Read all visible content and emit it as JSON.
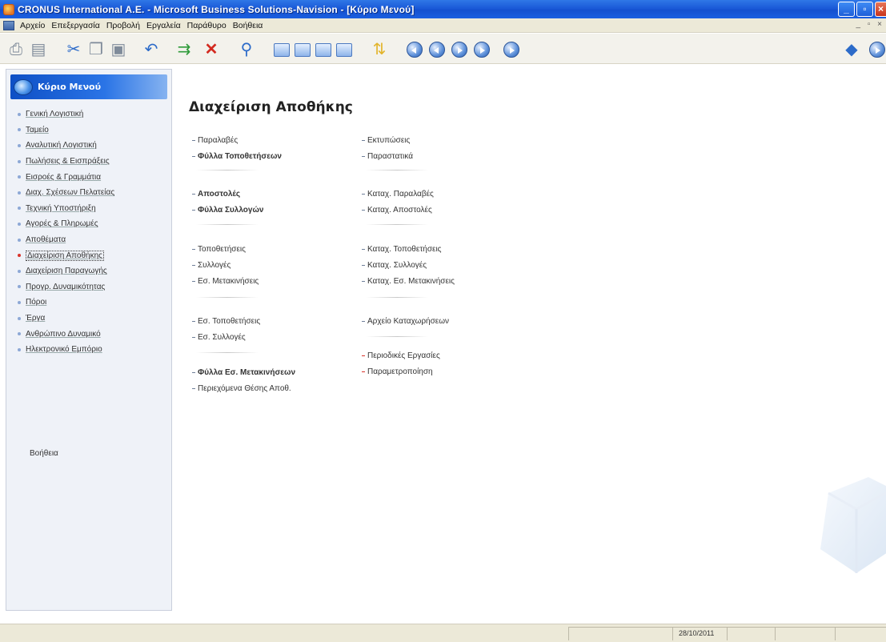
{
  "window": {
    "title": "CRONUS International A.E. - Microsoft Business Solutions-Navision - [Κύριο Μενού]"
  },
  "menubar": {
    "items": [
      "Αρχείο",
      "Επεξεργασία",
      "Προβολή",
      "Εργαλεία",
      "Παράθυρο",
      "Βοήθεια"
    ],
    "mdi_controls": "_ ▫ ×"
  },
  "toolbar": {
    "icons": [
      "print-icon",
      "print-preview-icon",
      "cut-icon",
      "copy-icon",
      "paste-icon",
      "undo-icon",
      "export-icon",
      "delete-icon",
      "find-icon",
      "card-view-icon",
      "list-view-icon",
      "statistics-icon",
      "table-icon",
      "sort-icon",
      "first-record-icon",
      "previous-record-icon",
      "next-record-icon",
      "last-record-icon",
      "navigate-icon",
      "menu-globe-icon",
      "help-icon"
    ]
  },
  "nav": {
    "header": "Κύριο Μενού",
    "items": [
      "Γενική Λογιστική",
      "Ταμείο",
      "Αναλυτική Λογιστική",
      "Πωλήσεις & Εισπράξεις",
      "Εισροές & Γραμμάτια",
      "Διαχ. Σχέσεων Πελατείας",
      "Τεχνική Υποστήριξη",
      "Αγορές & Πληρωμές",
      "Αποθέματα",
      "Διαχείριση Αποθήκης",
      "Διαχείριση Παραγωγής",
      "Προγρ. Δυναμικότητας",
      "Πόροι",
      "Έργα",
      "Ανθρώπινο Δυναμικό",
      "Ηλεκτρονικό Εμπόριο"
    ],
    "active_index": 9,
    "help": "Βοήθεια"
  },
  "main": {
    "title": "Διαχείριση Αποθήκης",
    "left_column": [
      {
        "label": "Παραλαβές"
      },
      {
        "label": "Φύλλα Τοποθετήσεων"
      },
      {
        "label": "Αποστολές"
      },
      {
        "label": "Φύλλα Συλλογών"
      },
      {
        "label": "Τοποθετήσεις"
      },
      {
        "label": "Συλλογές"
      },
      {
        "label": "Εσ. Μετακινήσεις"
      },
      {
        "label": "Εσ. Τοποθετήσεις"
      },
      {
        "label": "Εσ. Συλλογές"
      },
      {
        "label": "Φύλλα Εσ. Μετακινήσεων"
      },
      {
        "label": "Περιεχόμενα Θέσης Αποθ."
      }
    ],
    "right_column": [
      {
        "label": "Εκτυπώσεις"
      },
      {
        "label": "Παραστατικά"
      },
      {
        "label": "Καταχ. Παραλαβές"
      },
      {
        "label": "Καταχ. Αποστολές"
      },
      {
        "label": "Καταχ. Τοποθετήσεις"
      },
      {
        "label": "Καταχ. Συλλογές"
      },
      {
        "label": "Καταχ. Εσ. Μετακινήσεις"
      },
      {
        "label": "Αρχείο Καταχωρήσεων"
      },
      {
        "label": "Περιοδικές Εργασίες"
      },
      {
        "label": "Παραμετροποίηση"
      }
    ]
  },
  "statusbar": {
    "date": "28/10/2011"
  },
  "colors": {
    "titlebar": "#1a5ad8",
    "nav_header": "#1b62d4",
    "active_bullet": "#d9342b"
  }
}
